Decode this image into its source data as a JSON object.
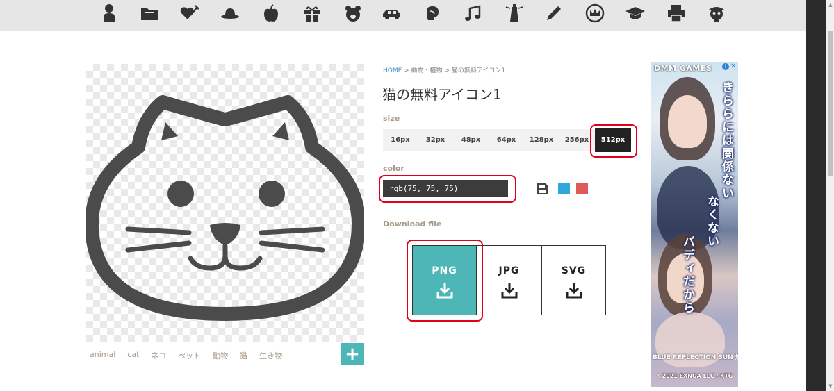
{
  "category_bar": {
    "icons": [
      "person-icon",
      "folder-icon",
      "heart-syringe-icon",
      "hat-icon",
      "apple-icon",
      "gift-icon",
      "bear-icon",
      "car-icon",
      "boxing-glove-icon",
      "music-note-icon",
      "lighthouse-icon",
      "pencil-icon",
      "crown-badge-icon",
      "graduation-cap-icon",
      "printer-icon",
      "pirate-skull-icon"
    ]
  },
  "breadcrumb": {
    "home": "HOME",
    "sep": " > ",
    "category": "動物・植物",
    "current": "猫の無料アイコン1"
  },
  "title": "猫の無料アイコン1",
  "size": {
    "label": "size",
    "options": [
      "16px",
      "32px",
      "48px",
      "64px",
      "128px",
      "256px",
      "512px"
    ],
    "selected": "512px"
  },
  "color": {
    "label": "color",
    "value": "rgb(75, 75, 75)",
    "icon_color": "#4b4b4b",
    "swatches": [
      "#2ea8dc",
      "#e05a5a"
    ]
  },
  "download": {
    "label": "Download file",
    "formats": [
      "PNG",
      "JPG",
      "SVG"
    ],
    "highlighted": "PNG",
    "accent": "#4db6b6"
  },
  "tags": [
    "animal",
    "cat",
    "ネコ",
    "ペット",
    "動物",
    "猫",
    "生き物"
  ],
  "add_tag_label": "+",
  "ad": {
    "brand": "DMM GAMES",
    "info_icon": "i",
    "close_icon": "✕",
    "copy1": "きららには関係ない",
    "copy2": "なくない",
    "copy3": "バディだから",
    "game_title": "BLUE REFLECTION SUN 燦",
    "copyright": "©2021 EXNOA LLC / KTG"
  }
}
